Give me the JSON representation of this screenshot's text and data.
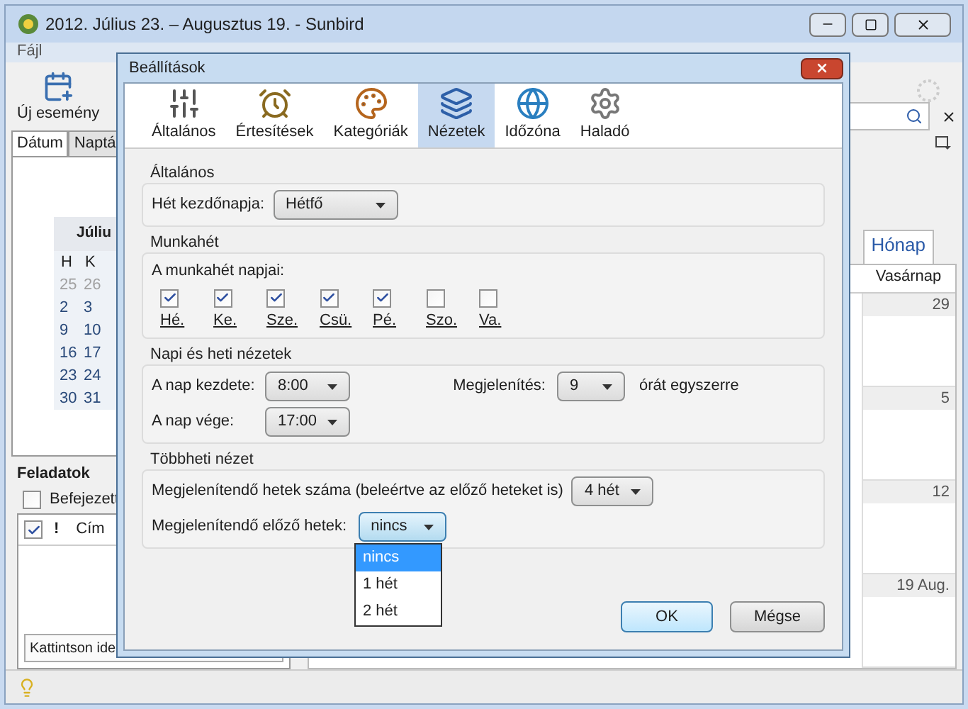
{
  "window": {
    "title": "2012. Július 23. – Augusztus 19. - Sunbird"
  },
  "menu": [
    "Fájl"
  ],
  "toolbar": [
    "Új esemény"
  ],
  "left_tabs": [
    {
      "label": "Dátum",
      "selected": true
    },
    {
      "label": "Naptá",
      "selected": false
    }
  ],
  "mini_calendar": {
    "month": "Júliu",
    "weekdays": [
      "H",
      "K"
    ],
    "rows": [
      {
        "days": [
          "25",
          "26"
        ],
        "other_month": true
      },
      {
        "days": [
          "2",
          "3"
        ],
        "other_month": false
      },
      {
        "days": [
          "9",
          "10"
        ],
        "other_month": false
      },
      {
        "days": [
          "16",
          "17"
        ],
        "other_month": false
      },
      {
        "days": [
          "23",
          "24"
        ],
        "other_month": false
      },
      {
        "days": [
          "30",
          "31"
        ],
        "other_month": false
      }
    ]
  },
  "tasks": {
    "title": "Feladatok",
    "completed_filter": {
      "label": "Befejezett",
      "checked": false
    },
    "columns": [
      "!",
      "Cím"
    ],
    "done_checked": true,
    "new_task": "Kattintson ide"
  },
  "view_tabs": [
    {
      "label": "Hónap",
      "selected": true
    }
  ],
  "month_view": {
    "column": "Vasárnap",
    "rows": [
      {
        "sunday": "29"
      },
      {
        "sunday": "5"
      },
      {
        "sunday": "12"
      },
      {
        "sunday": "19 Aug."
      }
    ]
  },
  "dialog": {
    "title": "Beállítások",
    "tabs": [
      {
        "label": "Általános",
        "selected": false,
        "kind": "sliders"
      },
      {
        "label": "Értesítések",
        "selected": false,
        "kind": "alarm"
      },
      {
        "label": "Kategóriák",
        "selected": false,
        "kind": "palette"
      },
      {
        "label": "Nézetek",
        "selected": true,
        "kind": "views"
      },
      {
        "label": "Időzóna",
        "selected": false,
        "kind": "timezone"
      },
      {
        "label": "Haladó",
        "selected": false,
        "kind": "gear"
      }
    ],
    "general": {
      "title": "Általános",
      "week_start": {
        "label": "Hét kezdőnapja:",
        "value": "Hétfő"
      }
    },
    "workweek": {
      "title": "Munkahét",
      "label": "A munkahét napjai:",
      "days": [
        {
          "label": "Hé.",
          "checked": true
        },
        {
          "label": "Ke.",
          "checked": true
        },
        {
          "label": "Sze.",
          "checked": true
        },
        {
          "label": "Csü.",
          "checked": true
        },
        {
          "label": "Pé.",
          "checked": true
        },
        {
          "label": "Szo.",
          "checked": false
        },
        {
          "label": "Va.",
          "checked": false
        }
      ]
    },
    "day_week": {
      "title": "Napi és heti nézetek",
      "start": {
        "label": "A nap kezdete:",
        "value": "8:00"
      },
      "end": {
        "label": "A nap vége:",
        "value": "17:00"
      },
      "show": {
        "label": "Megjelenítés:",
        "value": "9",
        "suffix": "órát egyszerre"
      }
    },
    "multiweek": {
      "title": "Többheti nézet",
      "weeks": {
        "label": "Megjelenítendő hetek száma (beleértve az előző heteket is)",
        "value": "4 hét"
      },
      "previous": {
        "label": "Megjelenítendő előző hetek:",
        "value": "nincs",
        "expanded": true,
        "options": [
          {
            "label": "nincs",
            "selected": true
          },
          {
            "label": "1 hét",
            "selected": false
          },
          {
            "label": "2 hét",
            "selected": false
          }
        ]
      }
    },
    "buttons": [
      "OK",
      "Mégse"
    ]
  }
}
